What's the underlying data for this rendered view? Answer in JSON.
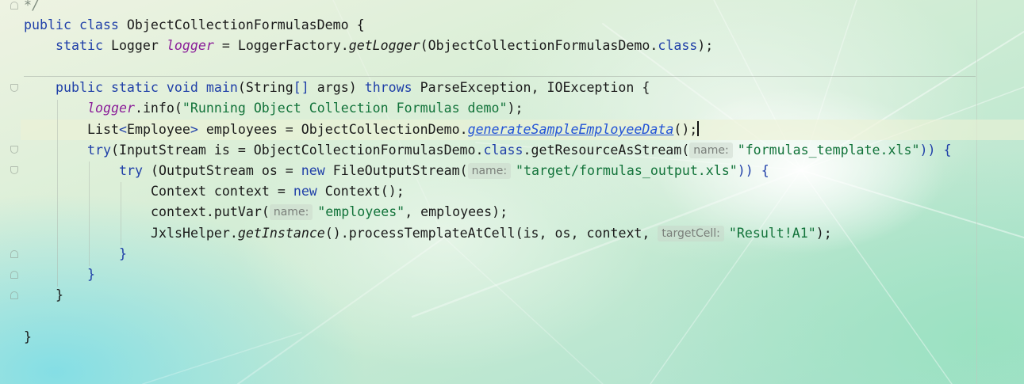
{
  "editor": {
    "colors": {
      "keyword": "#1f3fa8",
      "string": "#12733a",
      "field": "#8a1c98",
      "link": "#2253d6",
      "hint_text": "#7a7f7a"
    },
    "comment_end": "*/",
    "class_decl": {
      "kw_public": "public",
      "kw_class": "class",
      "name": "ObjectCollectionFormulasDemo",
      "brace": " {"
    },
    "logger_decl": {
      "kw_static": "static",
      "type": "Logger",
      "field": "logger",
      "assign": " = LoggerFactory.",
      "method": "getLogger",
      "arg": "(ObjectCollectionFormulasDemo.",
      "kw_class": "class",
      "end": ");"
    },
    "main_decl": {
      "kw_public": "public",
      "kw_static": "static",
      "kw_void": "void",
      "name": "main",
      "params_open": "(String",
      "bracket": "[]",
      "params_rest": " args) ",
      "kw_throws": "throws",
      "exceptions": " ParseException, IOException {"
    },
    "log_call": {
      "field": "logger",
      "call": ".info(",
      "message": "\"Running Object Collection Formulas demo\"",
      "end": ");"
    },
    "employees_decl": {
      "type_start": "List",
      "lt": "<",
      "generic": "Employee",
      "gt": ">",
      "assign": " employees = ObjectCollectionDemo.",
      "method": "generateSampleEmployeeData",
      "end": "();"
    },
    "try_input": {
      "kw_try": "try",
      "decl": "(InputStream is = ObjectCollectionFormulasDemo.",
      "kw_class": "class",
      "call": ".getResourceAsStream(",
      "hint": "name:",
      "value": "\"formulas_template.xls\"",
      "end": ")) {"
    },
    "try_output": {
      "kw_try": "try",
      "decl": " (OutputStream os = ",
      "kw_new": "new",
      "call": " FileOutputStream(",
      "hint": "name:",
      "value": "\"target/formulas_output.xls\"",
      "end": ")) {"
    },
    "context_decl": {
      "start": "Context context = ",
      "kw_new": "new",
      "end": " Context();"
    },
    "put_var": {
      "call": "context.putVar(",
      "hint": "name:",
      "value": "\"employees\"",
      "end": ", employees);"
    },
    "process": {
      "start": "JxlsHelper.",
      "method": "getInstance",
      "call": "().processTemplateAtCell(is, os, context, ",
      "hint": "targetCell:",
      "value": "\"Result!A1\"",
      "end": ");"
    },
    "closing": {
      "inner_try": "}",
      "outer_try": "}",
      "method": "}",
      "class": "}"
    }
  }
}
